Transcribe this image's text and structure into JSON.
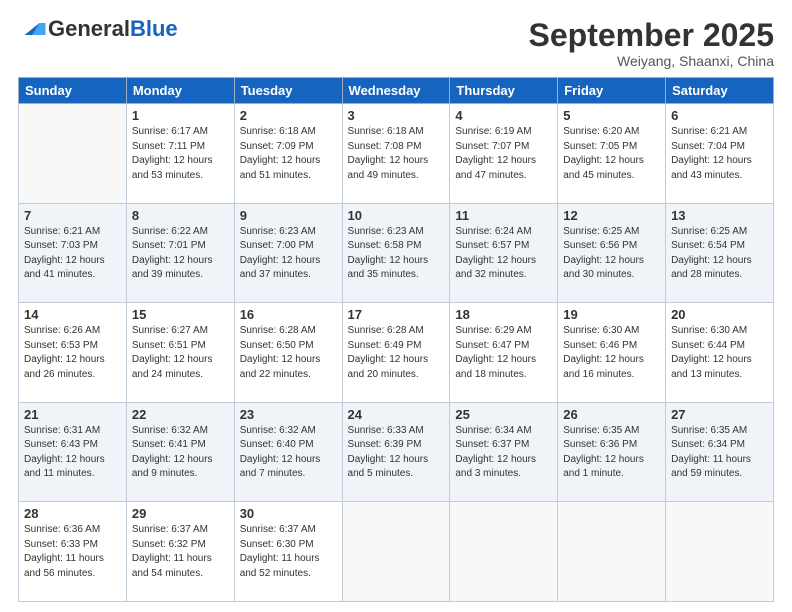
{
  "header": {
    "logo_general": "General",
    "logo_blue": "Blue",
    "month": "September 2025",
    "location": "Weiyang, Shaanxi, China"
  },
  "days_of_week": [
    "Sunday",
    "Monday",
    "Tuesday",
    "Wednesday",
    "Thursday",
    "Friday",
    "Saturday"
  ],
  "weeks": [
    [
      {
        "num": "",
        "content": ""
      },
      {
        "num": "1",
        "content": "Sunrise: 6:17 AM\nSunset: 7:11 PM\nDaylight: 12 hours\nand 53 minutes."
      },
      {
        "num": "2",
        "content": "Sunrise: 6:18 AM\nSunset: 7:09 PM\nDaylight: 12 hours\nand 51 minutes."
      },
      {
        "num": "3",
        "content": "Sunrise: 6:18 AM\nSunset: 7:08 PM\nDaylight: 12 hours\nand 49 minutes."
      },
      {
        "num": "4",
        "content": "Sunrise: 6:19 AM\nSunset: 7:07 PM\nDaylight: 12 hours\nand 47 minutes."
      },
      {
        "num": "5",
        "content": "Sunrise: 6:20 AM\nSunset: 7:05 PM\nDaylight: 12 hours\nand 45 minutes."
      },
      {
        "num": "6",
        "content": "Sunrise: 6:21 AM\nSunset: 7:04 PM\nDaylight: 12 hours\nand 43 minutes."
      }
    ],
    [
      {
        "num": "7",
        "content": "Sunrise: 6:21 AM\nSunset: 7:03 PM\nDaylight: 12 hours\nand 41 minutes."
      },
      {
        "num": "8",
        "content": "Sunrise: 6:22 AM\nSunset: 7:01 PM\nDaylight: 12 hours\nand 39 minutes."
      },
      {
        "num": "9",
        "content": "Sunrise: 6:23 AM\nSunset: 7:00 PM\nDaylight: 12 hours\nand 37 minutes."
      },
      {
        "num": "10",
        "content": "Sunrise: 6:23 AM\nSunset: 6:58 PM\nDaylight: 12 hours\nand 35 minutes."
      },
      {
        "num": "11",
        "content": "Sunrise: 6:24 AM\nSunset: 6:57 PM\nDaylight: 12 hours\nand 32 minutes."
      },
      {
        "num": "12",
        "content": "Sunrise: 6:25 AM\nSunset: 6:56 PM\nDaylight: 12 hours\nand 30 minutes."
      },
      {
        "num": "13",
        "content": "Sunrise: 6:25 AM\nSunset: 6:54 PM\nDaylight: 12 hours\nand 28 minutes."
      }
    ],
    [
      {
        "num": "14",
        "content": "Sunrise: 6:26 AM\nSunset: 6:53 PM\nDaylight: 12 hours\nand 26 minutes."
      },
      {
        "num": "15",
        "content": "Sunrise: 6:27 AM\nSunset: 6:51 PM\nDaylight: 12 hours\nand 24 minutes."
      },
      {
        "num": "16",
        "content": "Sunrise: 6:28 AM\nSunset: 6:50 PM\nDaylight: 12 hours\nand 22 minutes."
      },
      {
        "num": "17",
        "content": "Sunrise: 6:28 AM\nSunset: 6:49 PM\nDaylight: 12 hours\nand 20 minutes."
      },
      {
        "num": "18",
        "content": "Sunrise: 6:29 AM\nSunset: 6:47 PM\nDaylight: 12 hours\nand 18 minutes."
      },
      {
        "num": "19",
        "content": "Sunrise: 6:30 AM\nSunset: 6:46 PM\nDaylight: 12 hours\nand 16 minutes."
      },
      {
        "num": "20",
        "content": "Sunrise: 6:30 AM\nSunset: 6:44 PM\nDaylight: 12 hours\nand 13 minutes."
      }
    ],
    [
      {
        "num": "21",
        "content": "Sunrise: 6:31 AM\nSunset: 6:43 PM\nDaylight: 12 hours\nand 11 minutes."
      },
      {
        "num": "22",
        "content": "Sunrise: 6:32 AM\nSunset: 6:41 PM\nDaylight: 12 hours\nand 9 minutes."
      },
      {
        "num": "23",
        "content": "Sunrise: 6:32 AM\nSunset: 6:40 PM\nDaylight: 12 hours\nand 7 minutes."
      },
      {
        "num": "24",
        "content": "Sunrise: 6:33 AM\nSunset: 6:39 PM\nDaylight: 12 hours\nand 5 minutes."
      },
      {
        "num": "25",
        "content": "Sunrise: 6:34 AM\nSunset: 6:37 PM\nDaylight: 12 hours\nand 3 minutes."
      },
      {
        "num": "26",
        "content": "Sunrise: 6:35 AM\nSunset: 6:36 PM\nDaylight: 12 hours\nand 1 minute."
      },
      {
        "num": "27",
        "content": "Sunrise: 6:35 AM\nSunset: 6:34 PM\nDaylight: 11 hours\nand 59 minutes."
      }
    ],
    [
      {
        "num": "28",
        "content": "Sunrise: 6:36 AM\nSunset: 6:33 PM\nDaylight: 11 hours\nand 56 minutes."
      },
      {
        "num": "29",
        "content": "Sunrise: 6:37 AM\nSunset: 6:32 PM\nDaylight: 11 hours\nand 54 minutes."
      },
      {
        "num": "30",
        "content": "Sunrise: 6:37 AM\nSunset: 6:30 PM\nDaylight: 11 hours\nand 52 minutes."
      },
      {
        "num": "",
        "content": ""
      },
      {
        "num": "",
        "content": ""
      },
      {
        "num": "",
        "content": ""
      },
      {
        "num": "",
        "content": ""
      }
    ]
  ]
}
